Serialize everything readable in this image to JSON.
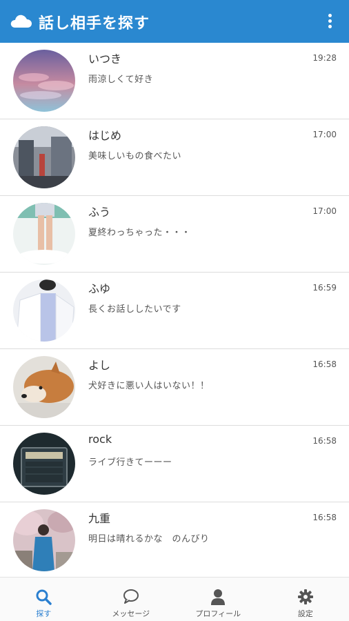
{
  "header": {
    "title": "話し相手を探す",
    "brand_icon": "cloud-icon",
    "menu_icon": "kebab-menu-icon",
    "color": "#2a88d0"
  },
  "users": [
    {
      "name": "いつき",
      "time": "19:28",
      "message": "雨涼しくて好き"
    },
    {
      "name": "はじめ",
      "time": "17:00",
      "message": "美味しいもの食べたい"
    },
    {
      "name": "ふう",
      "time": "17:00",
      "message": "夏終わっちゃった・・・"
    },
    {
      "name": "ふゆ",
      "time": "16:59",
      "message": "長くお話ししたいです"
    },
    {
      "name": "よし",
      "time": "16:58",
      "message": "犬好きに悪い人はいない！！"
    },
    {
      "name": "rock",
      "time": "16:58",
      "message": "ライブ行きてーーー"
    },
    {
      "name": "九重",
      "time": "16:58",
      "message": "明日は晴れるかな　のんびり"
    }
  ],
  "tabs": [
    {
      "label": "探す",
      "icon": "search-icon",
      "active": true
    },
    {
      "label": "メッセージ",
      "icon": "chat-bubble-icon",
      "active": false
    },
    {
      "label": "プロフィール",
      "icon": "person-icon",
      "active": false
    },
    {
      "label": "設定",
      "icon": "gear-icon",
      "active": false
    }
  ],
  "colors": {
    "accent": "#2a88d0",
    "active_tab": "#2a7fd0",
    "divider": "#dcdcdc"
  }
}
